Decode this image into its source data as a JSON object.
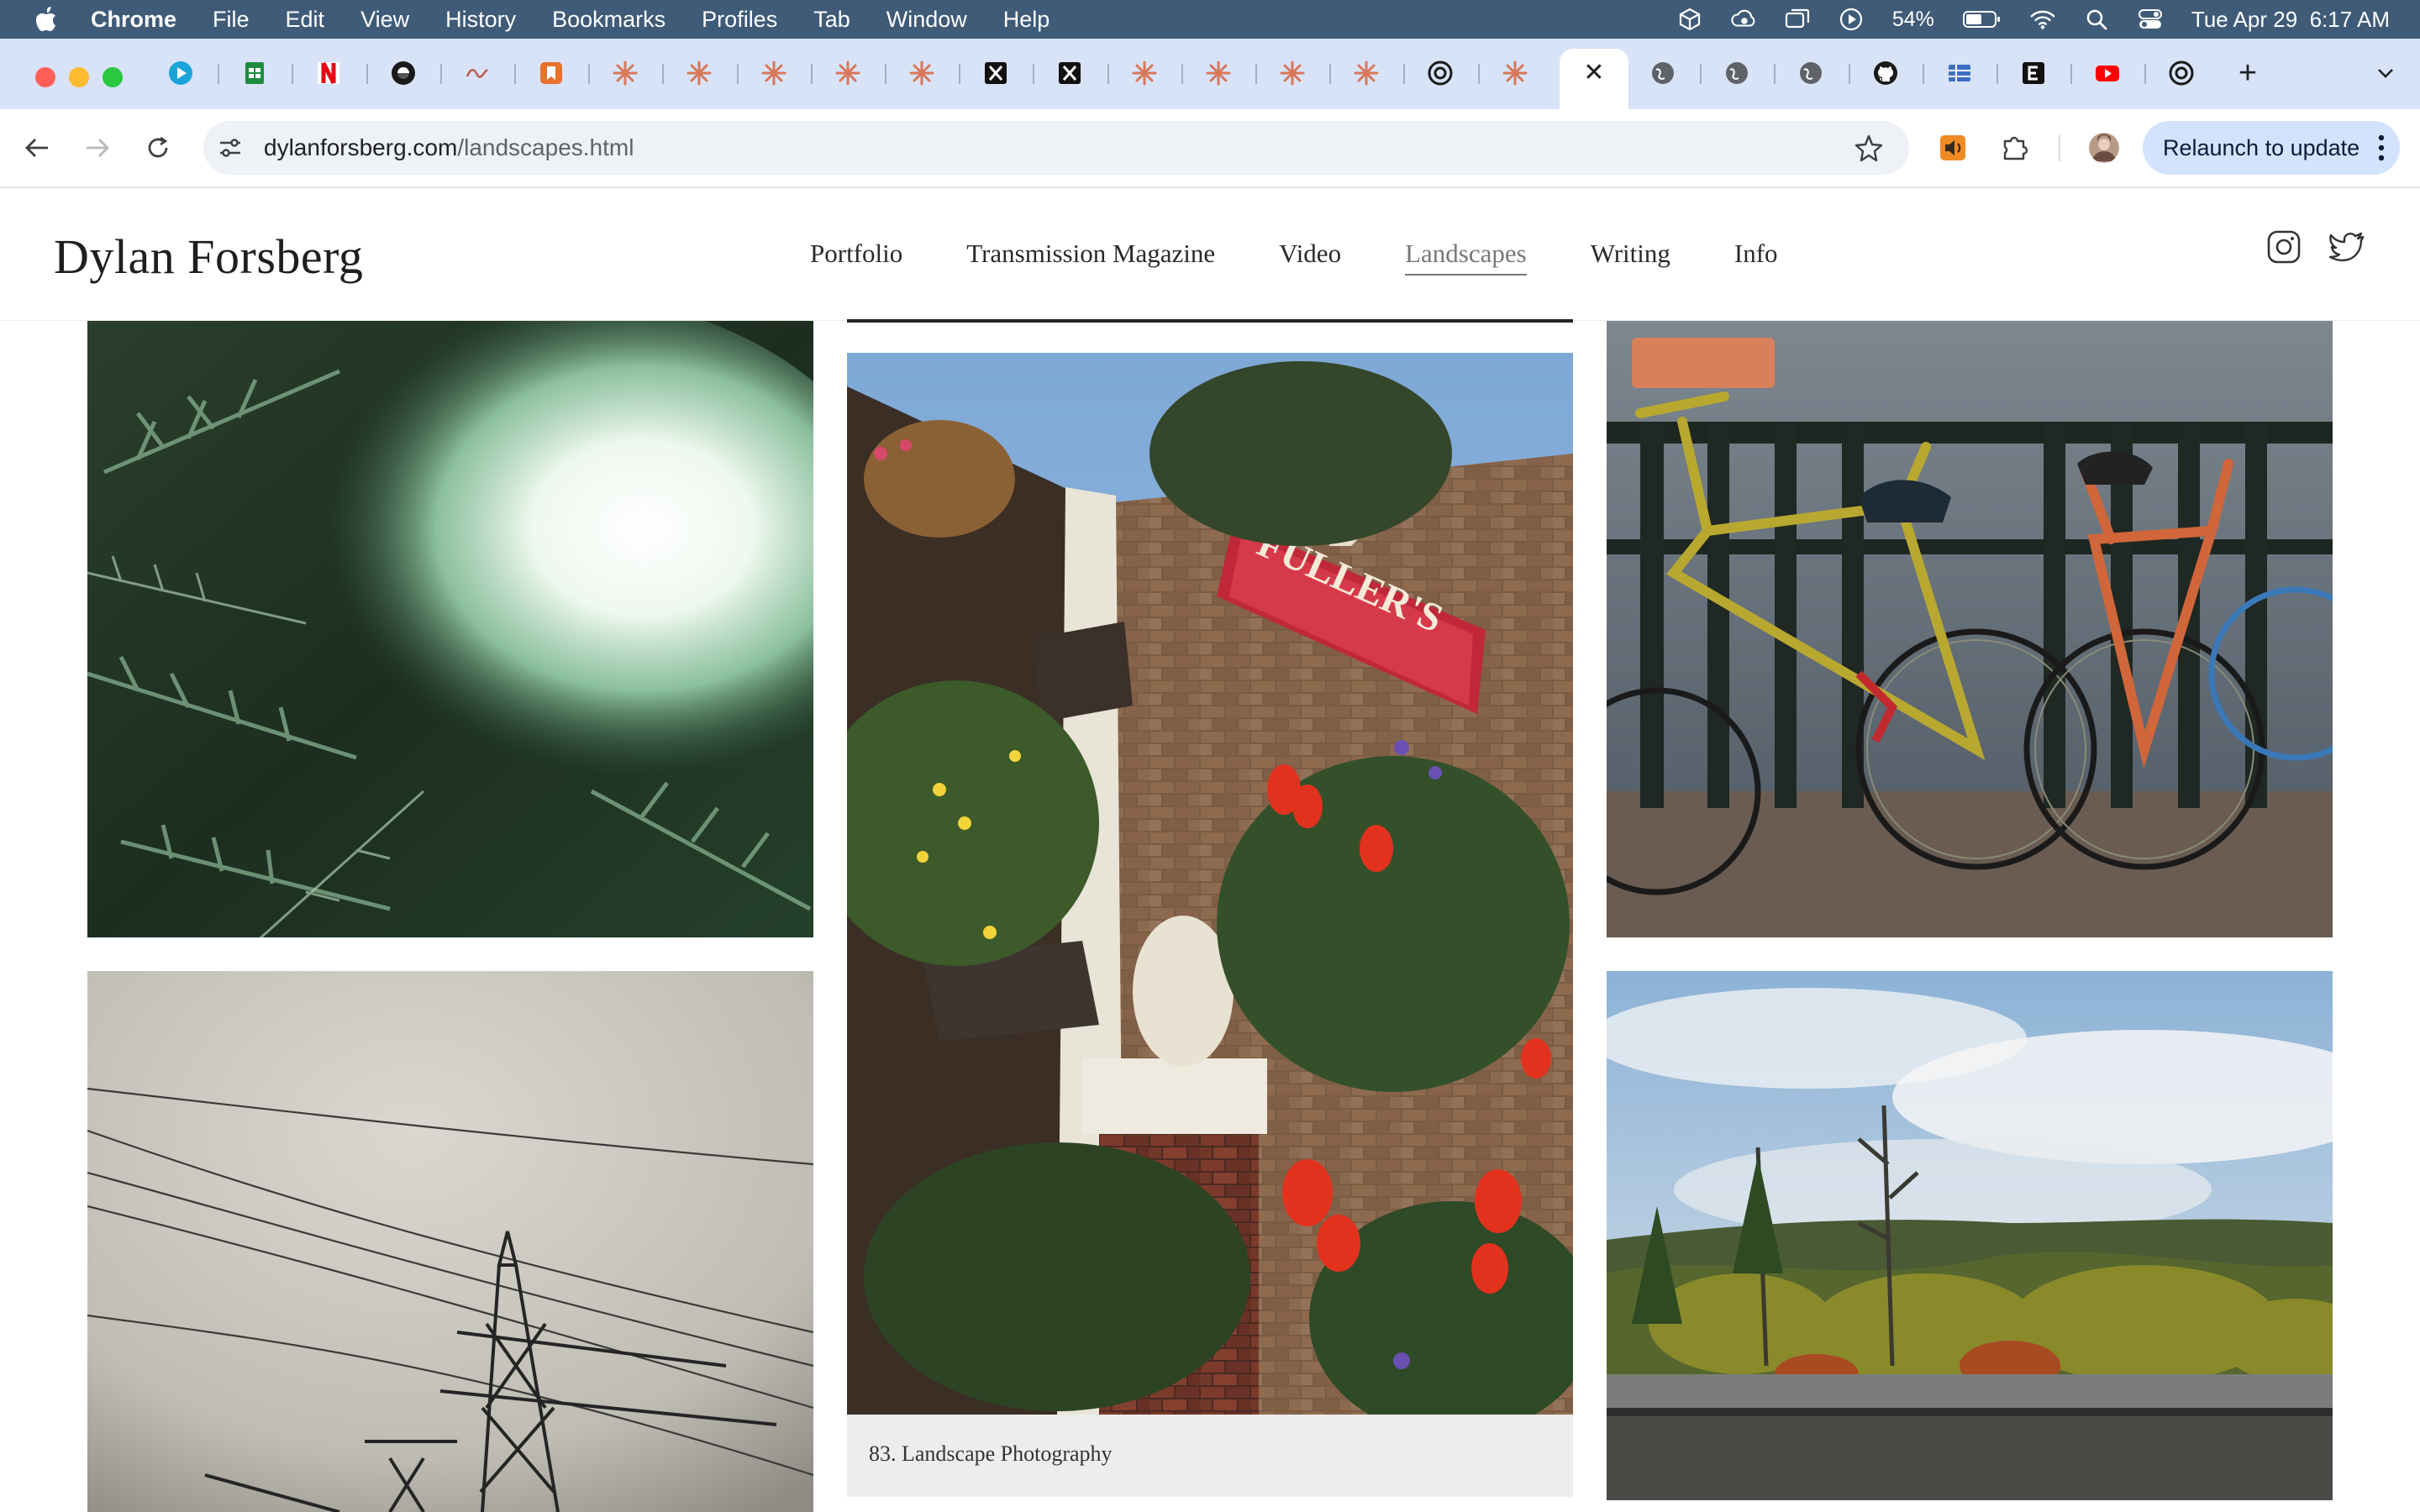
{
  "menubar": {
    "app": "Chrome",
    "items": [
      "File",
      "Edit",
      "View",
      "History",
      "Bookmarks",
      "Profiles",
      "Tab",
      "Window",
      "Help"
    ],
    "battery": "54%",
    "datetime": "Tue Apr 29  6:17 AM"
  },
  "tabs": {
    "favicons": [
      "play-icon",
      "sheets-icon",
      "netflix-icon",
      "bitwarden-icon",
      "wave-icon",
      "bookmark-icon",
      "claude-icon",
      "claude-icon",
      "claude-icon",
      "claude-icon",
      "claude-icon",
      "x-icon",
      "x-icon",
      "claude-icon",
      "claude-icon",
      "claude-icon",
      "claude-icon",
      "openai-icon",
      "claude-icon",
      "close-icon",
      "globe-icon",
      "globe-icon",
      "globe-icon",
      "github-icon",
      "grid-icon",
      "e-icon",
      "youtube-icon",
      "openai-icon"
    ],
    "new_tab": "+"
  },
  "toolbar": {
    "url_domain": "dylanforsberg.com",
    "url_path": "/landscapes.html",
    "relaunch_label": "Relaunch to update"
  },
  "site": {
    "title": "Dylan Forsberg",
    "nav": [
      "Portfolio",
      "Transmission Magazine",
      "Video",
      "Landscapes",
      "Writing",
      "Info"
    ],
    "active_nav": "Landscapes"
  },
  "gallery": {
    "caption": "83. Landscape Photography",
    "photos": [
      "forest-light-leak",
      "fullers-pub-flowers",
      "bicycles-by-canal",
      "power-pylon-sky",
      "lake-treeline"
    ]
  }
}
